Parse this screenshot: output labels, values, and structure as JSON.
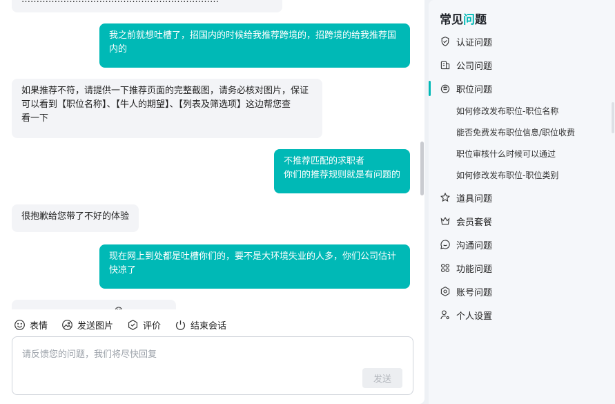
{
  "messages": [
    {
      "role": "agent",
      "text": "…………………………………………………………"
    },
    {
      "role": "user",
      "text": "我之前就想吐槽了，招国内的时候给我推荐跨境的，招跨境的给我推荐国\n内的"
    },
    {
      "role": "agent",
      "text": "如果推荐不符，请提供一下推荐页面的完整截图，请务必核对图片，保证\n可以看到【职位名称】、【牛人的期望】、【列表及筛选项】这边帮您查\n看一下"
    },
    {
      "role": "user",
      "text": "不推荐匹配的求职者\n你们的推荐规则就是有问题的"
    },
    {
      "role": "agent",
      "text": "很抱歉给您带了不好的体验"
    },
    {
      "role": "user",
      "text": "现在网上到处都是吐槽你们的，要不是大环境失业的人多，你们公司估计\n快凉了"
    },
    {
      "role": "agent",
      "text": "………………………… 😊"
    }
  ],
  "toolbar": {
    "emoji": "表情",
    "image": "发送图片",
    "rate": "评价",
    "end": "结束会话"
  },
  "input": {
    "placeholder": "请反馈您的问题，我们将尽快回复",
    "value": "",
    "send_label": "发送"
  },
  "faq": {
    "title_prefix": "常见",
    "title_accent": "问",
    "title_suffix": "题",
    "categories": [
      {
        "icon": "shield-check-icon",
        "label": "认证问题"
      },
      {
        "icon": "building-icon",
        "label": "公司问题"
      },
      {
        "icon": "briefcase-icon",
        "label": "职位问题",
        "active": true,
        "items": [
          "如何修改发布职位-职位名称",
          "能否免费发布职位信息/职位收费",
          "职位审核什么时候可以通过",
          "如何修改发布职位-职位类别"
        ]
      },
      {
        "icon": "star-tool-icon",
        "label": "道具问题"
      },
      {
        "icon": "crown-icon",
        "label": "会员套餐"
      },
      {
        "icon": "chat-bubble-icon",
        "label": "沟通问题"
      },
      {
        "icon": "grid-icon",
        "label": "功能问题"
      },
      {
        "icon": "hexagon-gear-icon",
        "label": "账号问题"
      },
      {
        "icon": "person-gear-icon",
        "label": "个人设置"
      }
    ]
  },
  "colors": {
    "accent": "#00b9b6",
    "agent_bubble": "#f3f4f7"
  }
}
